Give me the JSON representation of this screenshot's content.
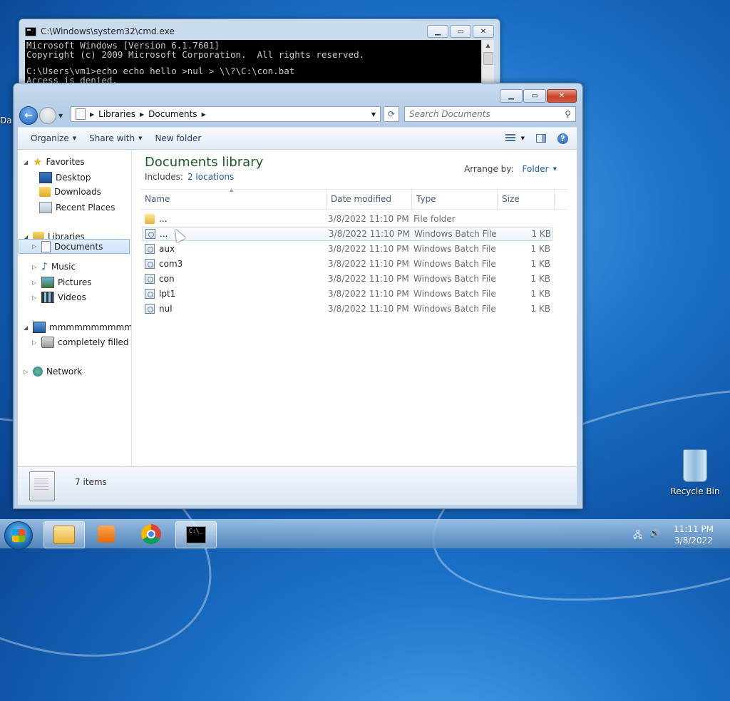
{
  "desktop": {
    "recycle_bin_label": "Recycle Bin",
    "left_edge_label": "Da"
  },
  "cmd": {
    "title": "C:\\Windows\\system32\\cmd.exe",
    "lines": [
      "Microsoft Windows [Version 6.1.7601]",
      "Copyright (c) 2009 Microsoft Corporation.  All rights reserved.",
      "",
      "C:\\Users\\vm1>echo echo hello >nul > \\\\?\\C:\\con.bat",
      "Access is denied."
    ]
  },
  "explorer": {
    "address": {
      "crumbs": [
        "Libraries",
        "Documents"
      ]
    },
    "search_placeholder": "Search Documents",
    "toolbar": {
      "organize": "Organize",
      "share_with": "Share with",
      "new_folder": "New folder"
    },
    "nav": {
      "favorites": "Favorites",
      "desktop": "Desktop",
      "downloads": "Downloads",
      "recent_places": "Recent Places",
      "libraries": "Libraries",
      "documents": "Documents",
      "music": "Music",
      "pictures": "Pictures",
      "videos": "Videos",
      "computer": "mmmmmmmmmmmmn",
      "drive": "completely filled (C:",
      "network": "Network"
    },
    "library_title": "Documents library",
    "includes_label": "Includes:",
    "includes_link": "2 locations",
    "arrange_label": "Arrange by:",
    "arrange_value": "Folder",
    "columns": {
      "name": "Name",
      "date": "Date modified",
      "type": "Type",
      "size": "Size"
    },
    "files": [
      {
        "name": "...",
        "date": "3/8/2022 11:10 PM",
        "type": "File folder",
        "size": ""
      },
      {
        "name": "...",
        "date": "3/8/2022 11:10 PM",
        "type": "Windows Batch File",
        "size": "1 KB"
      },
      {
        "name": "aux",
        "date": "3/8/2022 11:10 PM",
        "type": "Windows Batch File",
        "size": "1 KB"
      },
      {
        "name": "com3",
        "date": "3/8/2022 11:10 PM",
        "type": "Windows Batch File",
        "size": "1 KB"
      },
      {
        "name": "con",
        "date": "3/8/2022 11:10 PM",
        "type": "Windows Batch File",
        "size": "1 KB"
      },
      {
        "name": "lpt1",
        "date": "3/8/2022 11:10 PM",
        "type": "Windows Batch File",
        "size": "1 KB"
      },
      {
        "name": "nul",
        "date": "3/8/2022 11:10 PM",
        "type": "Windows Batch File",
        "size": "1 KB"
      }
    ],
    "status_count": "7 items"
  },
  "taskbar": {
    "time": "11:11 PM",
    "date": "3/8/2022",
    "cmd_icon_text": "C:\\_"
  }
}
